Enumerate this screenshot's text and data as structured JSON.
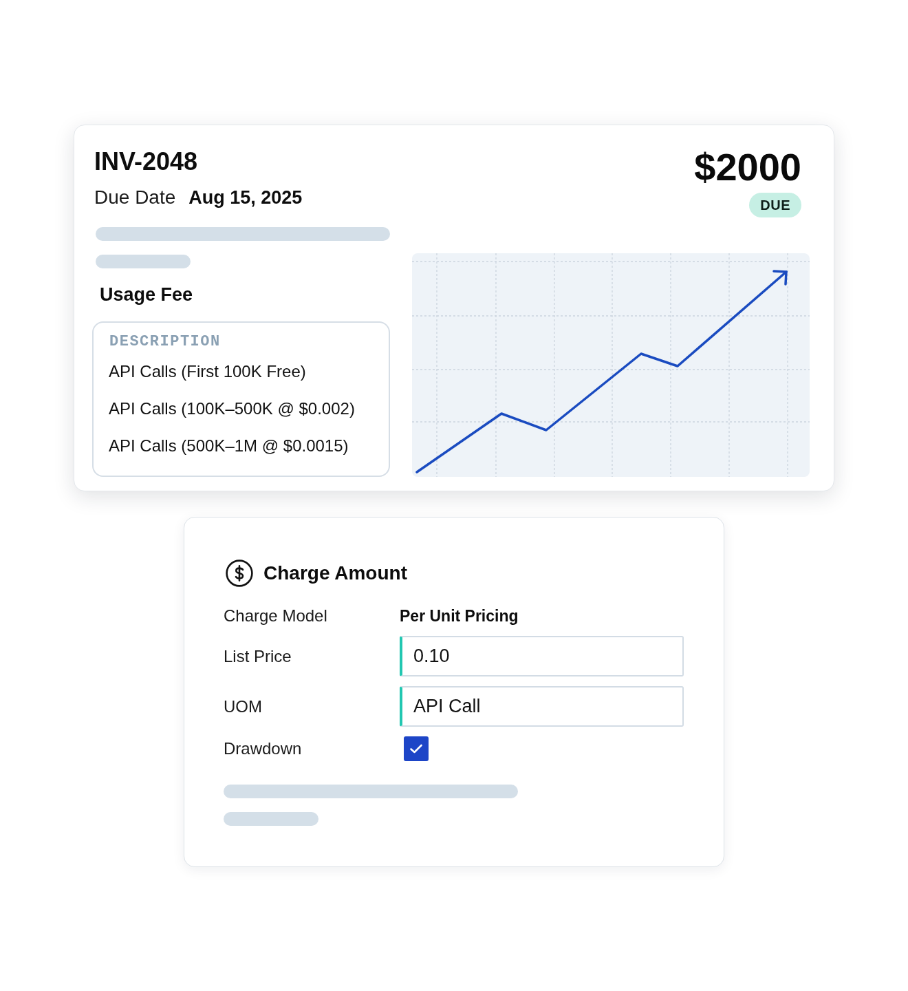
{
  "invoice": {
    "number": "INV-2048",
    "due_label": "Due Date",
    "due_date": "Aug 15, 2025",
    "amount": "$2000",
    "status": "DUE"
  },
  "usage_fee": {
    "title": "Usage Fee",
    "header": "DESCRIPTION",
    "items": [
      "API Calls (First 100K Free)",
      "API Calls (100K–500K @ $0.002)",
      "API Calls (500K–1M @ $0.0015)"
    ]
  },
  "charge_amount": {
    "title": "Charge Amount",
    "fields": [
      {
        "kind": "text",
        "label": "Charge Model",
        "value": "Per Unit Pricing"
      },
      {
        "kind": "input",
        "label": "List Price",
        "value": "0.10"
      },
      {
        "kind": "input",
        "label": "UOM",
        "value": "API Call"
      },
      {
        "kind": "checkbox",
        "label": "Drawdown",
        "checked": true
      }
    ]
  }
}
